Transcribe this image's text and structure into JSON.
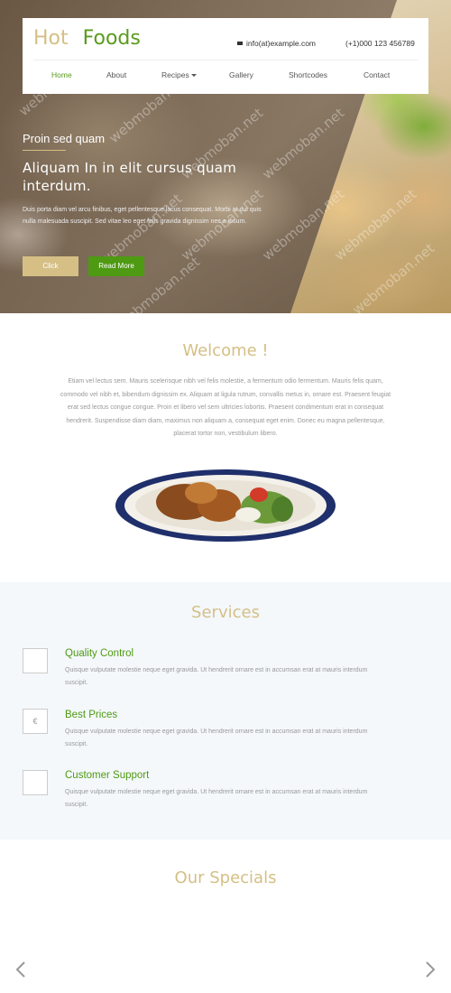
{
  "header": {
    "logo_word1": "Hot",
    "logo_word2": "Foods",
    "email": "info(at)example.com",
    "phone": "(+1)000 123 456789",
    "nav": [
      {
        "label": "Home",
        "active": true
      },
      {
        "label": "About",
        "active": false
      },
      {
        "label": "Recipes",
        "active": false,
        "has_dropdown": true
      },
      {
        "label": "Gallery",
        "active": false
      },
      {
        "label": "Shortcodes",
        "active": false
      },
      {
        "label": "Contact",
        "active": false
      }
    ]
  },
  "hero": {
    "kicker": "Proin sed quam",
    "title": "Aliquam In in elit cursus quam interdum.",
    "description": "Duis porta diam vel arcu finibus, eget pellentesque lacus consequat. Morbi at dui quis nulla malesuada suscipit. Sed vitae leo eget felis gravida dignissim nec a ipsum.",
    "btn_click": "Click",
    "btn_more": "Read More",
    "watermark": "webmoban.net"
  },
  "welcome": {
    "title": "Welcome !",
    "text": "Etiam vel lectus sem. Mauris scelerisque nibh vel felis molestie, a fermentum odio fermentum. Mauris felis quam, commodo vel nibh et, bibendum dignissim ex. Aliquam at ligula rutrum, convallis metus in, ornare est. Praesent feugiat erat sed lectus congue congue. Proin et libero vel sem ultricies lobortis. Praesent condimentum erat in consequat hendrerit. Suspendisse diam diam, maximus non aliquam a, consequat eget enim. Donec eu magna pellentesque, placerat tortor non, vestibulum libero."
  },
  "services": {
    "title": "Services",
    "items": [
      {
        "title": "Quality Control",
        "icon": "blank-icon",
        "desc": "Quisque vulputate molestie neque eget gravida. Ut hendrerit ornare est in accumsan erat at mauris interdum suscipit."
      },
      {
        "title": "Best Prices",
        "icon": "euro-icon",
        "icon_glyph": "€",
        "desc": "Quisque vulputate molestie neque eget gravida. Ut hendrerit ornare est in accumsan erat at mauris interdum suscipit."
      },
      {
        "title": "Customer Support",
        "icon": "blank-icon",
        "desc": "Quisque vulputate molestie neque eget gravida. Ut hendrerit ornare est in accumsan erat at mauris interdum suscipit."
      }
    ]
  },
  "specials": {
    "title": "Our Specials",
    "prev_icon": "chevron-left-icon",
    "next_icon": "chevron-right-icon"
  },
  "colors": {
    "accent_gold": "#d5bf85",
    "accent_green": "#4e9a12",
    "services_bg": "#f4f8fb"
  }
}
